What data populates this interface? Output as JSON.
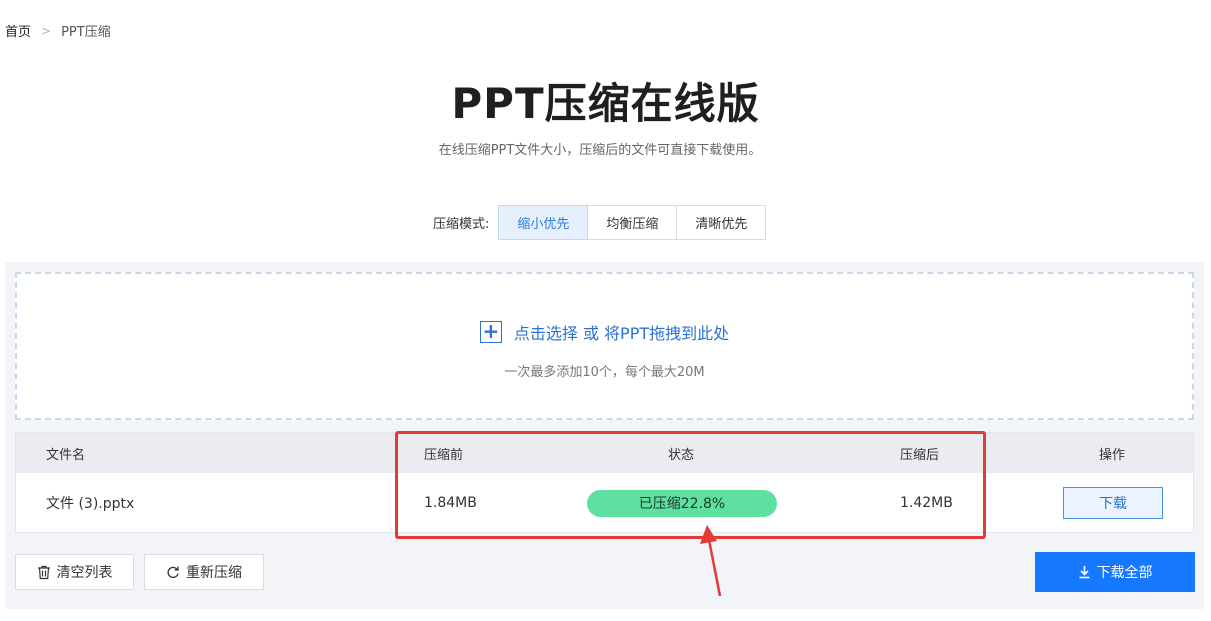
{
  "breadcrumb": {
    "home": "首页",
    "separator": ">",
    "current": "PPT压缩"
  },
  "header": {
    "title": "PPT压缩在线版",
    "subtitle": "在线压缩PPT文件大小，压缩后的文件可直接下载使用。"
  },
  "mode": {
    "label": "压缩模式:",
    "options": [
      "缩小优先",
      "均衡压缩",
      "清晰优先"
    ],
    "selected": "缩小优先"
  },
  "upload": {
    "icon": "plus-icon",
    "main_text": "点击选择 或 将PPT拖拽到此处",
    "hint": "一次最多添加10个，每个最大20M"
  },
  "table": {
    "headers": [
      "文件名",
      "压缩前",
      "状态",
      "压缩后",
      "操作"
    ],
    "rows": [
      {
        "filename": "文件 (3).pptx",
        "before": "1.84MB",
        "status": "已压缩22.8%",
        "after": "1.42MB",
        "action": "下载"
      }
    ]
  },
  "actions": {
    "clear_label": "清空列表",
    "recompress_label": "重新压缩",
    "download_all_label": "下载全部"
  },
  "colors": {
    "accent": "#1677ff",
    "status_green": "#5ee0a0",
    "highlight_red": "#e53935"
  }
}
